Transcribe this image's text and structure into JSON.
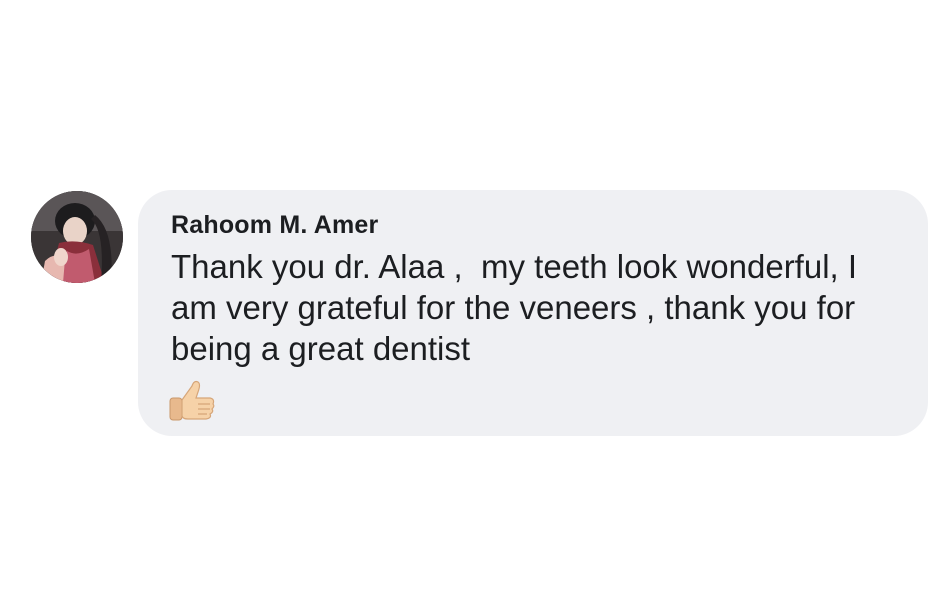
{
  "comment": {
    "author": "Rahoom M. Amer",
    "text": "Thank you dr. Alaa ,  my teeth look wonderful, I am very grateful for the veneers , thank you for being a great dentist",
    "emoji_icon": "thumbs-up-icon",
    "bubble_color": "#eff0f3",
    "text_color": "#1c1e21",
    "skin_tone": "#f6d2a8"
  }
}
